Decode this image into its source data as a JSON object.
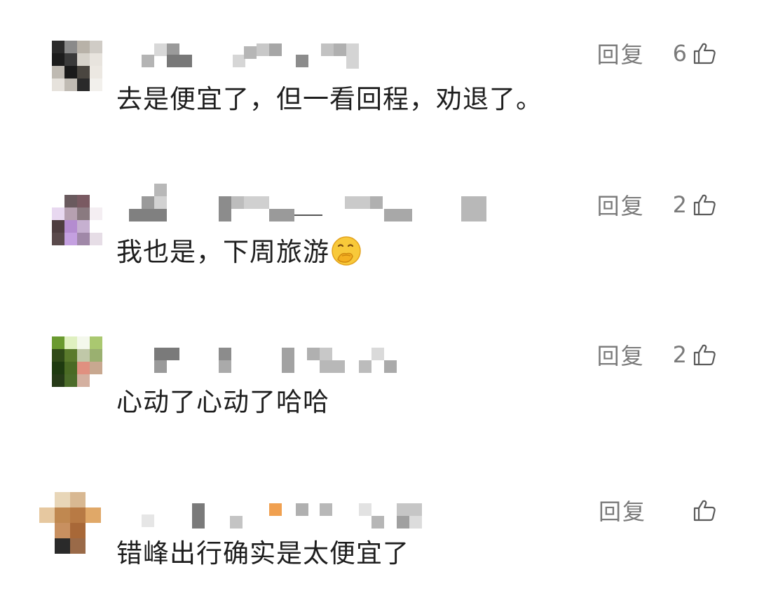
{
  "comments": [
    {
      "reply_label": "回复",
      "like_count": "6",
      "text": "去是便宜了，但一看回程，劝退了。",
      "avatar_colors": [
        "#2b2b2b",
        "#8a8a8a",
        "#b8b2a8",
        "#d0ccc6",
        "#1c1c1c",
        "#3a3a3a",
        "#d6d2ca",
        "#e8e4de",
        "#bfbab2",
        "#1a1a1a",
        "#4a4640",
        "#ece8e2",
        "#e6e2dc",
        "#c0bbb3",
        "#2a2a2a",
        "#f2f0ec"
      ]
    },
    {
      "reply_label": "回复",
      "like_count": "2",
      "text": "我也是，下周旅游",
      "emoji": "face-with-hand-over-mouth",
      "avatar_colors": [
        "#ffffff",
        "#6a5a5e",
        "#7a5a62",
        "#ffffff",
        "#e8d8f0",
        "#b6a0b0",
        "#8a7a80",
        "#f4eef2",
        "#4e3e40",
        "#b48cd0",
        "#c6b0d0",
        "#ffffff",
        "#5a4a4c",
        "#c4a0e0",
        "#a088a8",
        "#e6dde6"
      ]
    },
    {
      "reply_label": "回复",
      "like_count": "2",
      "text": "心动了心动了哈哈",
      "avatar_colors": [
        "#6a9a30",
        "#dff0c0",
        "#f4f8ec",
        "#aac870",
        "#304a18",
        "#5a7a2c",
        "#c0c8a8",
        "#9ab070",
        "#1e3a10",
        "#4a6a24",
        "#e09080",
        "#c8a890",
        "#263a18",
        "#4c6c2a",
        "#d4b0a0",
        "#ffffff"
      ]
    },
    {
      "reply_label": "回复",
      "like_count": "",
      "text": "错峰出行确实是太便宜了",
      "avatar_colors": [
        "#ffffff",
        "#e8d6b8",
        "#d8b892",
        "#ffffff",
        "#e6c8a0",
        "#c08850",
        "#b87a44",
        "#e0a868",
        "#ffffff",
        "#c89060",
        "#a86838",
        "#ffffff",
        "#ffffff",
        "#2a2a2a",
        "#9a6a48",
        "#ffffff"
      ]
    }
  ]
}
